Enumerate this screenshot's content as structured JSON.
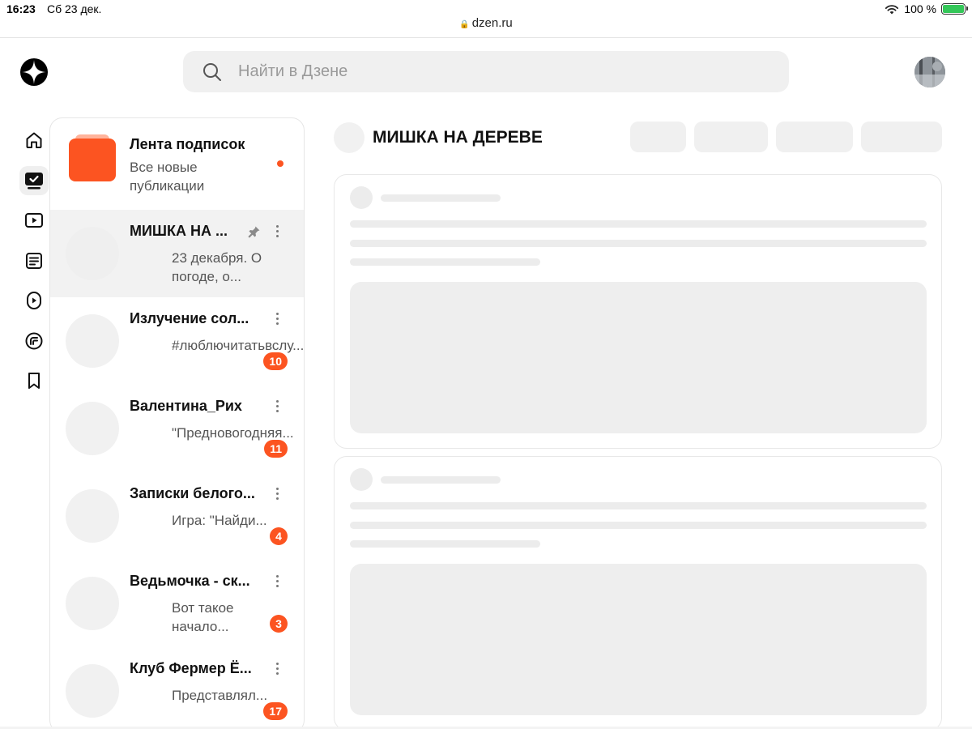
{
  "status_bar": {
    "time": "16:23",
    "date": "Сб 23 дек.",
    "battery": "100 %"
  },
  "browser": {
    "url": "dzen.ru"
  },
  "header": {
    "search_placeholder": "Найти в Дзене",
    "logo_icon": "dzen-logo-icon",
    "search_icon": "search-icon"
  },
  "sidenav": {
    "items": [
      {
        "icon": "home-icon",
        "active": false
      },
      {
        "icon": "subscriptions-icon",
        "active": true
      },
      {
        "icon": "video-icon",
        "active": false
      },
      {
        "icon": "articles-icon",
        "active": false
      },
      {
        "icon": "shorts-icon",
        "active": false
      },
      {
        "icon": "posts-icon",
        "active": false
      },
      {
        "icon": "bookmark-icon",
        "active": false
      }
    ]
  },
  "feed": {
    "title": "Лента подписок",
    "subtitle": "Все новые публикации"
  },
  "channels": [
    {
      "name": "МИШКА НА ...",
      "preview": "23 декабря. О погоде, о...",
      "badge": "",
      "pinned": true,
      "selected": true
    },
    {
      "name": "Излучение сол...",
      "preview": "#люблючитатьвслу...",
      "badge": "10",
      "pinned": false,
      "selected": false
    },
    {
      "name": "Валентина_Рих",
      "preview": "\"Предновогодняя...",
      "badge": "11",
      "pinned": false,
      "selected": false
    },
    {
      "name": "Записки белого...",
      "preview": "Игра: \"Найди...",
      "badge": "4",
      "pinned": false,
      "selected": false
    },
    {
      "name": "Ведьмочка - ск...",
      "preview": "Вот такое начало...",
      "badge": "3",
      "pinned": false,
      "selected": false
    },
    {
      "name": "Клуб Фермер Ё...",
      "preview": "Представлял...",
      "badge": "17",
      "pinned": false,
      "selected": false
    }
  ],
  "main": {
    "channel_title": "МИШКА НА ДЕРЕВЕ"
  },
  "colors": {
    "accent": "#fc5421",
    "skeleton": "#ececec"
  }
}
